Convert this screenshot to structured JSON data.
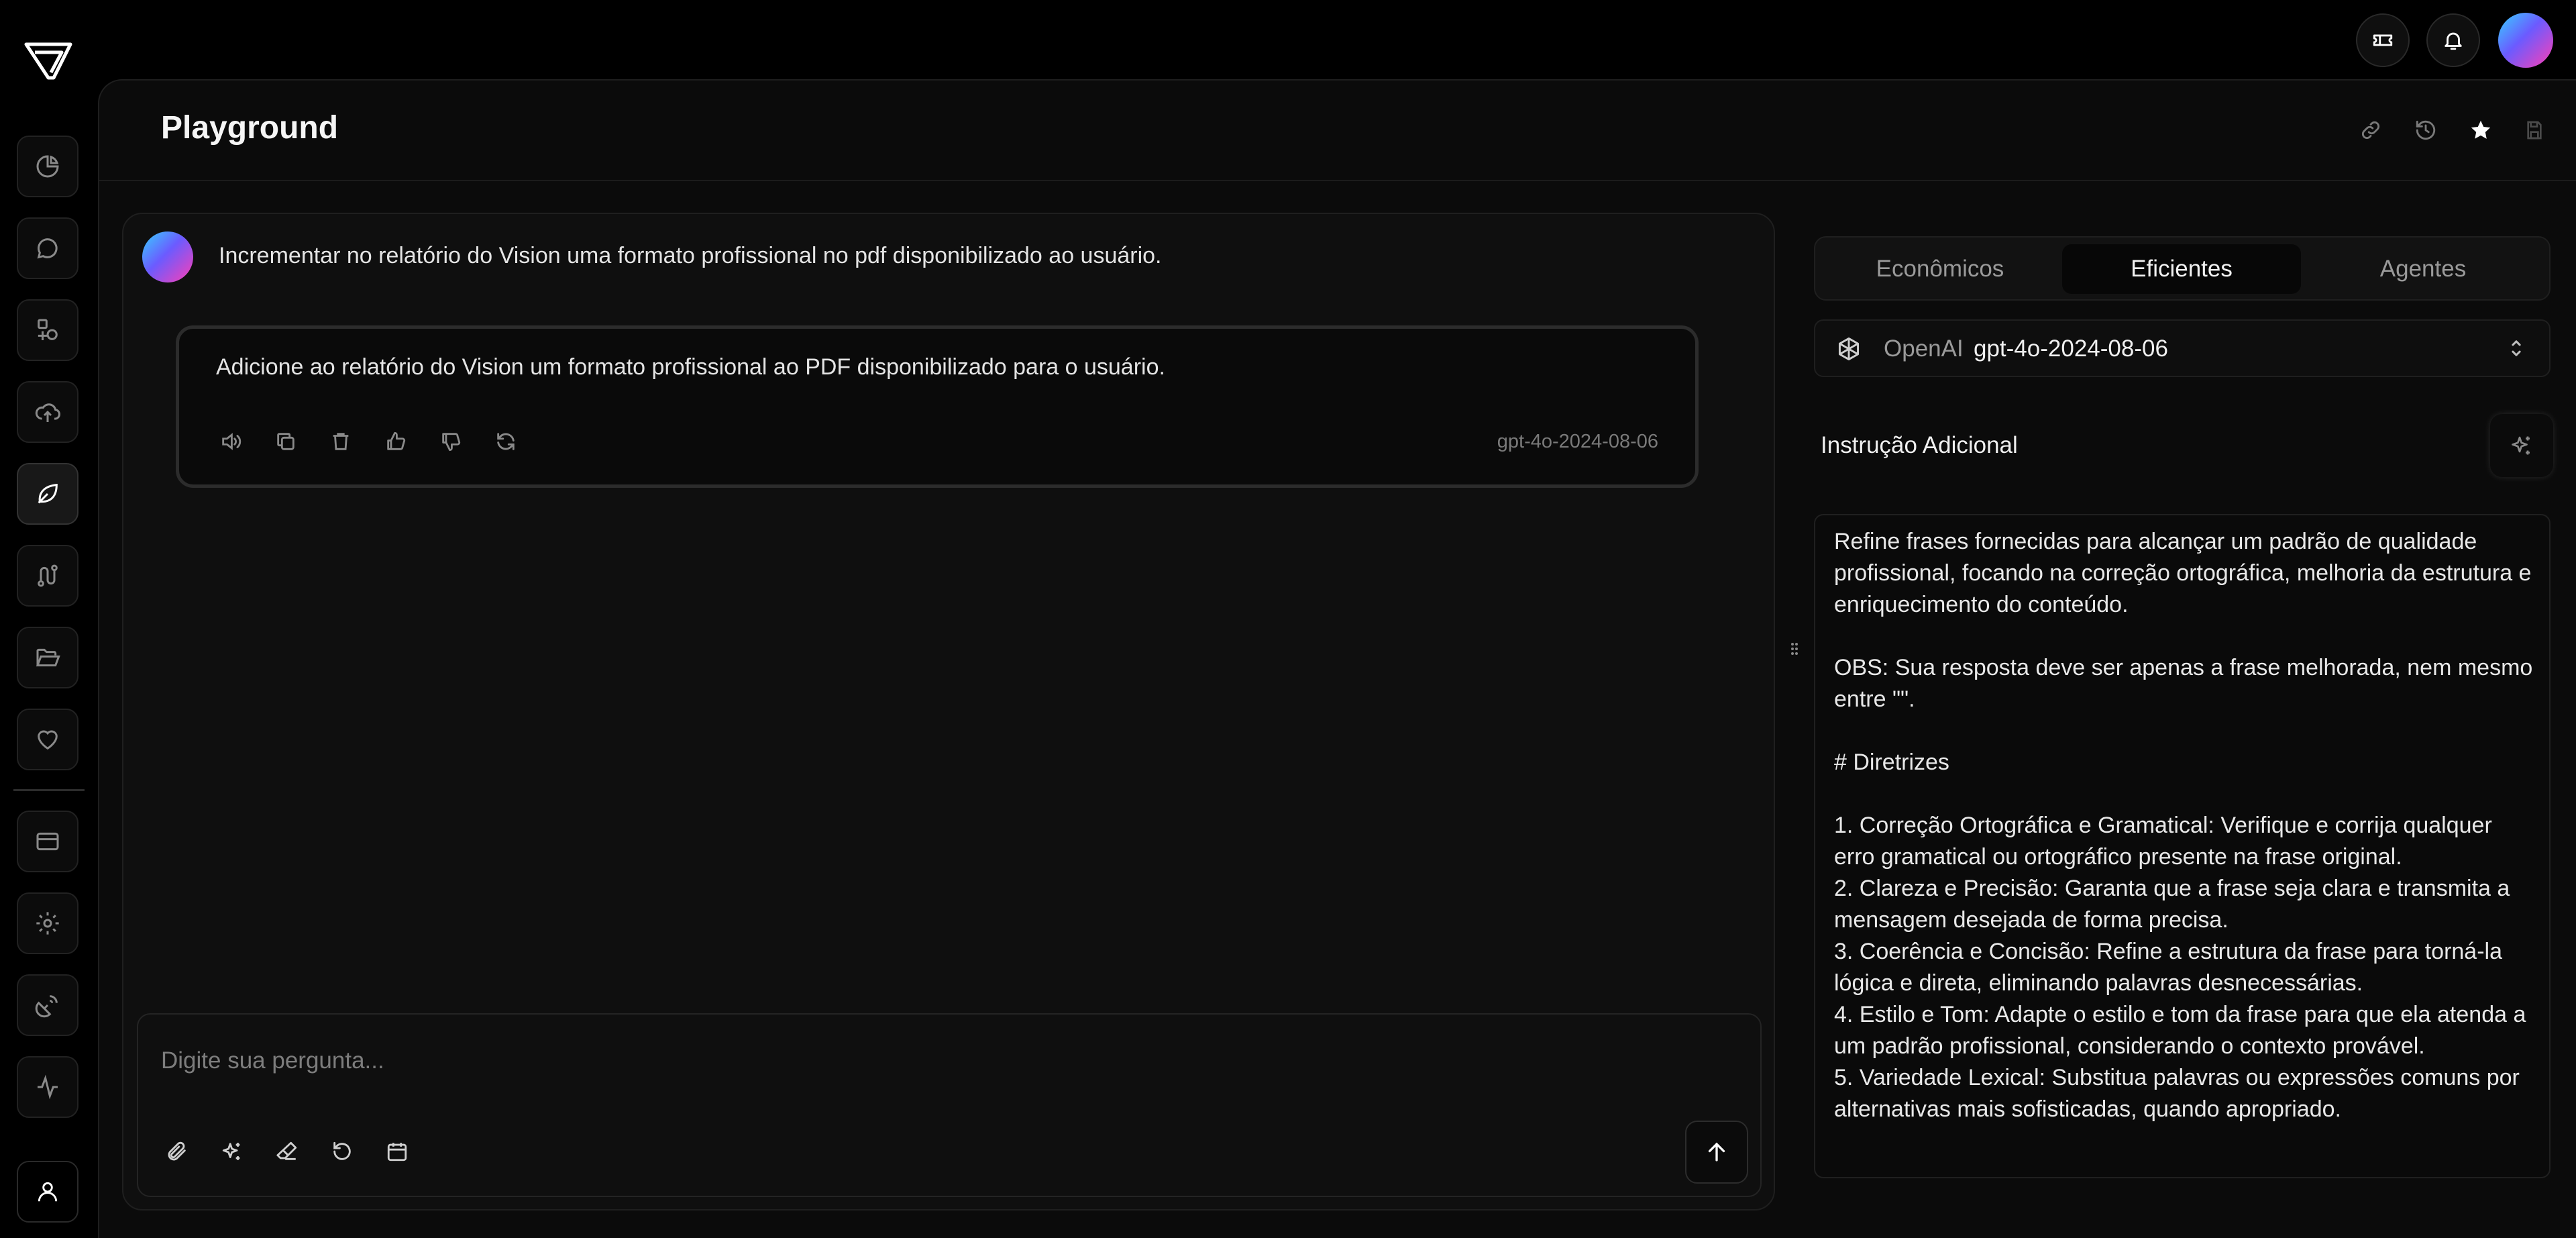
{
  "header": {
    "title": "Playground"
  },
  "chat": {
    "user_message": "Incrementar no relatório do Vision uma formato profissional no pdf disponibilizado ao usuário.",
    "response_text": "Adicione ao relatório do Vision um formato profissional ao PDF disponibilizado para o usuário.",
    "response_model": "gpt-4o-2024-08-06",
    "input_placeholder": "Digite sua pergunta..."
  },
  "panel": {
    "tabs": [
      "Econômicos",
      "Eficientes",
      "Agentes"
    ],
    "active_tab": "Eficientes",
    "provider": "OpenAI",
    "model": "gpt-4o-2024-08-06",
    "instruction_title": "Instrução Adicional",
    "instruction_text": "Refine frases fornecidas para alcançar um padrão de qualidade profissional, focando na correção ortográfica, melhoria da estrutura e enriquecimento do conteúdo.\n\nOBS: Sua resposta deve ser apenas a frase melhorada, nem mesmo entre \"\".\n\n# Diretrizes\n\n1. Correção Ortográfica e Gramatical: Verifique e corrija qualquer erro gramatical ou ortográfico presente na frase original.\n2. Clareza e Precisão: Garanta que a frase seja clara e transmita a mensagem desejada de forma precisa.\n3. Coerência e Concisão: Refine a estrutura da frase para torná-la lógica e direta, eliminando palavras desnecessárias.\n4. Estilo e Tom: Adapte o estilo e tom da frase para que ela atenda a um padrão profissional, considerando o contexto provável.\n5. Variedade Lexical: Substitua palavras ou expressões comuns por alternativas mais sofisticadas, quando apropriado."
  },
  "icons": {
    "topbar": [
      "ticket-icon",
      "bell-icon"
    ],
    "sidebar": [
      "pie-chart-icon",
      "chat-bubble-icon",
      "shapes-icon",
      "cloud-upload-icon",
      "leaf-icon",
      "route-icon",
      "folder-open-icon",
      "heart-icon",
      "credit-card-icon",
      "gear-icon",
      "satellite-icon",
      "activity-icon",
      "user-icon"
    ],
    "header_actions": [
      "link-icon",
      "history-icon",
      "star-icon",
      "save-icon"
    ],
    "message_actions": [
      "speaker-icon",
      "copy-icon",
      "trash-icon",
      "thumbs-up-icon",
      "thumbs-down-icon",
      "refresh-icon"
    ],
    "input_tools": [
      "paperclip-icon",
      "sparkles-icon",
      "eraser-icon",
      "undo-icon",
      "calendar-icon"
    ]
  }
}
